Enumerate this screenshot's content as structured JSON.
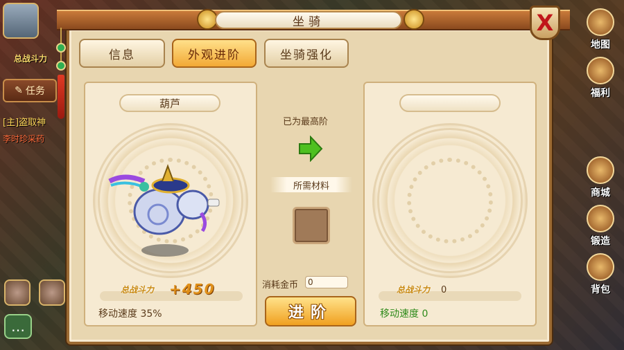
{
  "window": {
    "title": "坐骑",
    "close_label": "X"
  },
  "tabs": [
    {
      "label": "信息",
      "active": false
    },
    {
      "label": "外观进阶",
      "active": true
    },
    {
      "label": "坐骑强化",
      "active": false
    }
  ],
  "left_card": {
    "name": "葫芦",
    "power_label": "总战斗力",
    "power_value": "+450",
    "speed_text": "移动速度 35%"
  },
  "middle": {
    "max_text": "已为最高阶",
    "materials_label": "所需材料",
    "cost_label": "消耗金币",
    "cost_value": "0",
    "advance_button": "进阶"
  },
  "right_card": {
    "name": "",
    "power_label": "总战斗力",
    "power_value": "0",
    "speed_text": "移动速度 0"
  },
  "background_hud": {
    "left_zhanli": "总战斗力",
    "task_button": "任务",
    "chat_line": "[主]盗取神",
    "chat_sub": "李时珍采药",
    "right_buttons": [
      "地图",
      "福利",
      "商城",
      "锻造",
      "背包"
    ]
  },
  "colors": {
    "panel_bg": "#e8d6b0",
    "active_tab": "#f2a935",
    "power_gold": "#e0901a",
    "speed_green": "#2e8a1a",
    "close_red": "#c0161a"
  }
}
